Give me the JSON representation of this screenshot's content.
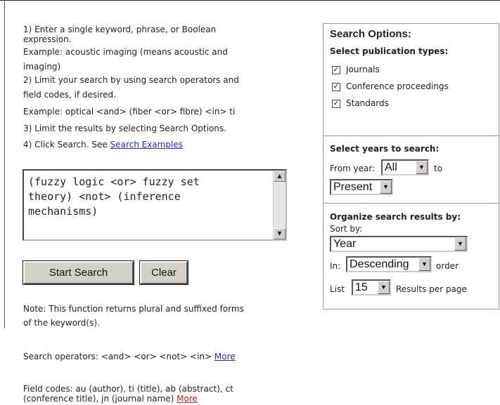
{
  "instructions": {
    "line1": "1) Enter a single keyword, phrase, or Boolean",
    "line2": "expression.",
    "line3": "Example: acoustic imaging (means acoustic and",
    "line4": "imaging)",
    "line5": "2) Limit your search by using search operators and",
    "line6": "field codes, if desired.",
    "line7": "Example: optical <and> (fiber <or> fibre) <in> ti",
    "line8": "3) Limit the results by selecting Search Options.",
    "line9_prefix": "4) Click Search. See ",
    "search_examples_link": "Search Examples"
  },
  "query": {
    "value": "(fuzzy logic <or> fuzzy set\ntheory) <not> (inference\nmechanisms)"
  },
  "buttons": {
    "start_search": "Start Search",
    "clear": "Clear"
  },
  "notes": {
    "note_line1": "Note: This function returns plural and suffixed forms",
    "note_line2": "of the keyword(s).",
    "operators_prefix": "Search operators: <and> <or> <not> <in> ",
    "operators_more": "More",
    "fields_line1": "Field codes: au (author), ti (title), ab (abstract), ct",
    "fields_line2_prefix": "(conference title), jn (journal name) ",
    "fields_more": "More"
  },
  "search_options": {
    "title": "Search Options:",
    "pub_types_label": "Select publication types:",
    "pub_types": [
      {
        "label": "Journals",
        "checked": true
      },
      {
        "label": "Conference proceedings",
        "checked": true
      },
      {
        "label": "Standards",
        "checked": true
      }
    ],
    "years_label": "Select years to search:",
    "from_year_label": "From year:",
    "from_year_value": "All",
    "to_label": "to",
    "to_year_value": "Present",
    "organize_label": "Organize search results by:",
    "sort_by_label": "Sort by:",
    "sort_by_value": "Year",
    "in_label": "In:",
    "order_value": "Descending",
    "order_label": "order",
    "list_label": "List",
    "list_value": "15",
    "results_per_page_label": "Results per page"
  }
}
